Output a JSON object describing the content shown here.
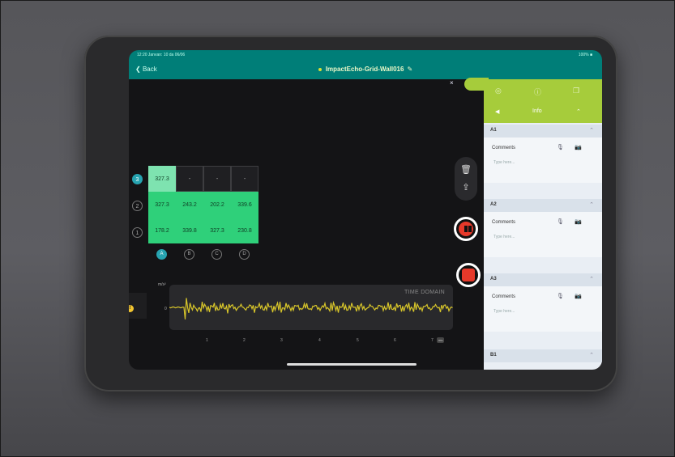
{
  "status": {
    "left": "12:20   Janvan: 10 da 06/06",
    "right": "100% ■"
  },
  "nav": {
    "back": "Back",
    "title": "ImpactEcho-Grid-Wall016",
    "edit_icon": "pencil-icon"
  },
  "grid": {
    "rows": [
      "3",
      "2",
      "1"
    ],
    "columns": [
      "A",
      "B",
      "C",
      "D"
    ],
    "cells": [
      [
        "327.3",
        "-",
        "-",
        "-"
      ],
      [
        "327.3",
        "243.2",
        "202.2",
        "339.6"
      ],
      [
        "178.2",
        "339.8",
        "327.3",
        "230.8"
      ]
    ],
    "active_row": "3",
    "active_column": "A"
  },
  "tools": {
    "delete": "trash-icon",
    "share": "share-icon"
  },
  "recording": {
    "pause": "pause-icon",
    "stop": "stop-icon"
  },
  "waveform": {
    "label": "TIME DOMAIN",
    "unit": "m/s²",
    "zero": "0",
    "ticks": [
      "1",
      "2",
      "3",
      "4",
      "5",
      "6",
      "7"
    ],
    "tick_unit": "ms"
  },
  "warning": {
    "text": "!"
  },
  "panel": {
    "close": "×",
    "nav": {
      "left": "◀",
      "title": "Info",
      "right": "⌃"
    },
    "sections": [
      {
        "name": "A1",
        "comments_label": "Comments",
        "placeholder": "Type here..."
      },
      {
        "name": "A2",
        "comments_label": "Comments",
        "placeholder": "Type here..."
      },
      {
        "name": "A3",
        "comments_label": "Comments",
        "placeholder": "Type here..."
      },
      {
        "name": "B1"
      }
    ]
  },
  "colors": {
    "toolbar": "#007e78",
    "panel_header": "#a6cc3b",
    "cell_green": "#2fd07a",
    "record": "#e6392a"
  }
}
